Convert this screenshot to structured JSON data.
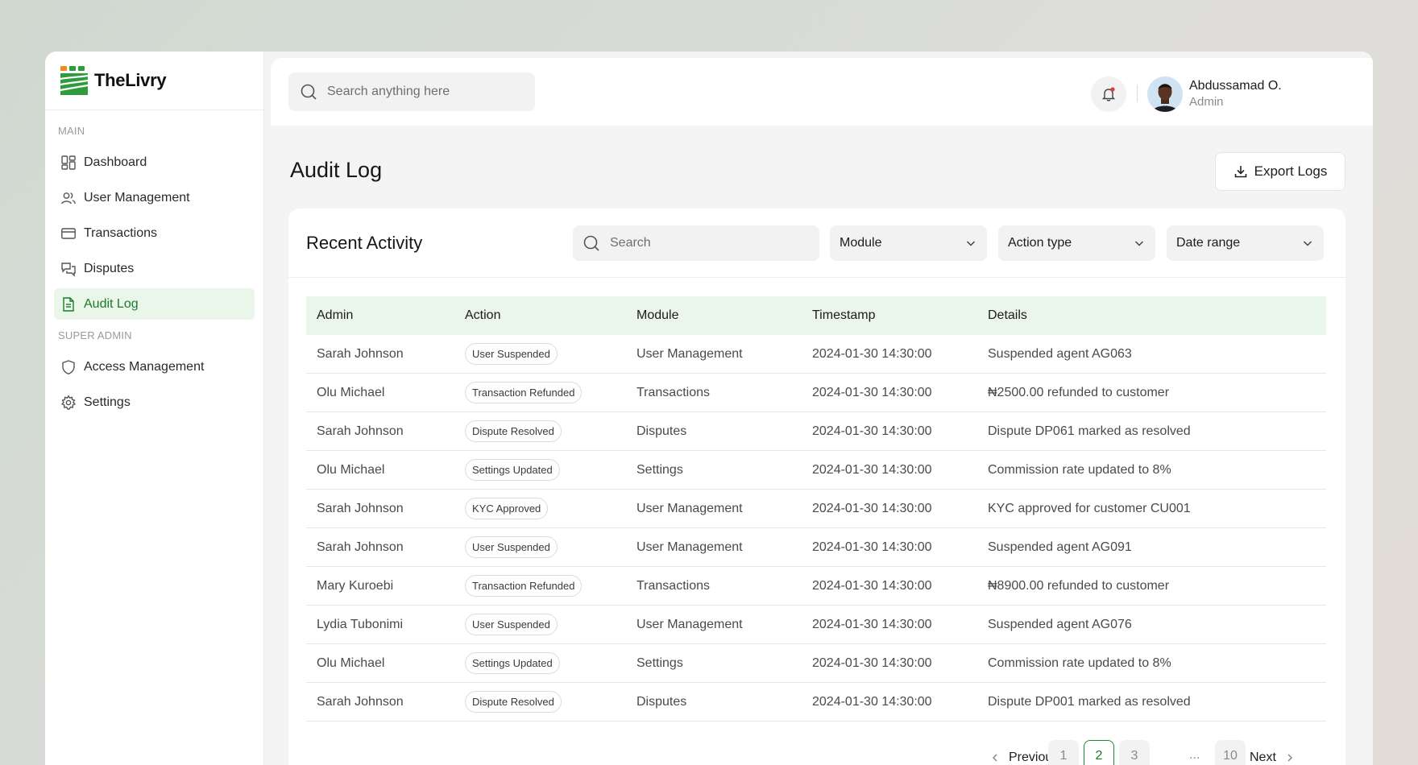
{
  "brand": {
    "name": "TheLivry",
    "accent": "#1b7a2a",
    "logo_green": "#2e9b3d",
    "logo_orange": "#f28a1e"
  },
  "sidebar": {
    "main_label": "MAIN",
    "super_admin_label": "SUPER ADMIN",
    "items": [
      {
        "label": "Dashboard",
        "icon": "dashboard-icon"
      },
      {
        "label": "User Management",
        "icon": "users-icon"
      },
      {
        "label": "Transactions",
        "icon": "card-icon"
      },
      {
        "label": "Disputes",
        "icon": "chat-icon"
      },
      {
        "label": "Audit Log",
        "icon": "document-icon",
        "active": true
      }
    ],
    "super_items": [
      {
        "label": "Access Management",
        "icon": "shield-icon"
      },
      {
        "label": "Settings",
        "icon": "gear-icon"
      }
    ]
  },
  "topbar": {
    "search_placeholder": "Search anything here",
    "user": {
      "name": "Abdussamad O.",
      "role": "Admin"
    }
  },
  "page": {
    "title": "Audit Log",
    "export_label": "Export Logs"
  },
  "card": {
    "title": "Recent Activity",
    "search_placeholder": "Search",
    "filters": {
      "module": "Module",
      "action_type": "Action type",
      "date_range": "Date range"
    }
  },
  "table": {
    "headers": [
      "Admin",
      "Action",
      "Module",
      "Timestamp",
      "Details"
    ],
    "rows": [
      [
        "Sarah Johnson",
        "User Suspended",
        "User Management",
        "2024-01-30 14:30:00",
        "Suspended agent AG063"
      ],
      [
        "Olu Michael",
        "Transaction Refunded",
        "Transactions",
        "2024-01-30 14:30:00",
        "₦2500.00 refunded to customer"
      ],
      [
        "Sarah Johnson",
        "Dispute Resolved",
        "Disputes",
        "2024-01-30 14:30:00",
        "Dispute DP061 marked as resolved"
      ],
      [
        "Olu Michael",
        "Settings Updated",
        "Settings",
        "2024-01-30 14:30:00",
        "Commission rate updated to 8%"
      ],
      [
        "Sarah Johnson",
        "KYC Approved",
        "User Management",
        "2024-01-30 14:30:00",
        "KYC approved for customer CU001"
      ],
      [
        "Sarah Johnson",
        "User Suspended",
        "User Management",
        "2024-01-30 14:30:00",
        "Suspended agent AG091"
      ],
      [
        "Mary Kuroebi",
        "Transaction Refunded",
        "Transactions",
        "2024-01-30 14:30:00",
        "₦8900.00 refunded to customer"
      ],
      [
        "Lydia Tubonimi",
        "User Suspended",
        "User Management",
        "2024-01-30 14:30:00",
        "Suspended agent AG076"
      ],
      [
        "Olu Michael",
        "Settings Updated",
        "Settings",
        "2024-01-30 14:30:00",
        "Commission rate updated to 8%"
      ],
      [
        "Sarah Johnson",
        "Dispute Resolved",
        "Disputes",
        "2024-01-30 14:30:00",
        "Dispute DP001 marked as resolved"
      ]
    ]
  },
  "pagination": {
    "previous": "Previous",
    "next": "Next",
    "pages": [
      "1",
      "2",
      "3",
      "10"
    ],
    "ellipsis": "...",
    "current": "2"
  }
}
